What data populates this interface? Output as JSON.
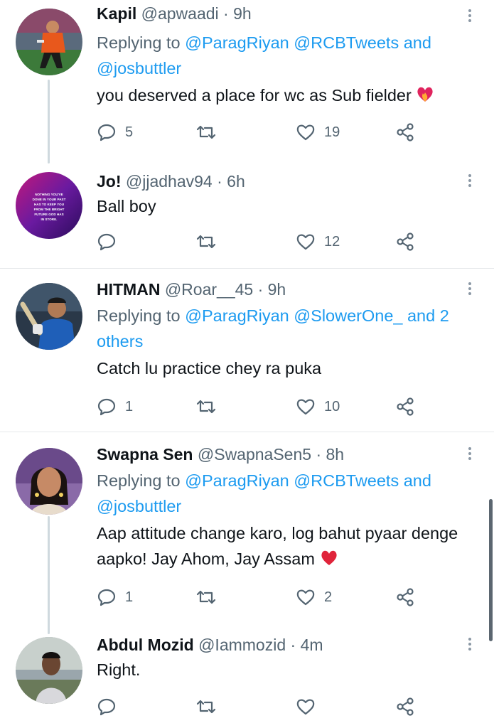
{
  "tweets": [
    {
      "name": "Kapil",
      "handle": "@apwaadi",
      "time": "· 9h",
      "replying_prefix": "Replying to ",
      "replying_mentions": "@ParagRiyan @RCBTweets and @josbuttler",
      "replying_suffix": "",
      "text": "you deserved a place for wc as Sub fielder",
      "text_emoji": "heart-on-fire",
      "replies": "5",
      "retweets": "",
      "likes": "19",
      "avatar_icon": "cricketer-orange-avatar"
    },
    {
      "name": "Jo!",
      "handle": "@jjadhav94",
      "time": "· 6h",
      "text": "Ball boy",
      "replies": "",
      "retweets": "",
      "likes": "12",
      "avatar_icon": "quote-purple-avatar",
      "avatar_text": [
        "NOTHING YOU'VE",
        "DONE IN YOUR PAST",
        "HAS TO KEEP YOU",
        "FROM THE BRIGHT",
        "FUTURE GOD HAS",
        "IN STORE."
      ]
    },
    {
      "name": "HITMAN",
      "handle": "@Roar__45",
      "time": "· 9h",
      "replying_prefix": "Replying to ",
      "replying_mentions": "@ParagRiyan @SlowerOne_ and 2 others",
      "text": "Catch lu practice chey ra puka",
      "replies": "1",
      "retweets": "",
      "likes": "10",
      "avatar_icon": "batsman-blue-avatar"
    },
    {
      "name": "Swapna Sen",
      "handle": "@SwapnaSen5",
      "time": "· 8h",
      "replying_prefix": "Replying to ",
      "replying_mentions": "@ParagRiyan @RCBTweets and @josbuttler",
      "text": "Aap attitude change karo, log bahut pyaar denge aapko! Jay Ahom, Jay Assam",
      "text_emoji": "red-heart",
      "replies": "1",
      "retweets": "",
      "likes": "2",
      "avatar_icon": "woman-portrait-avatar"
    },
    {
      "name": "Abdul Mozid",
      "handle": "@Iammozid",
      "time": "· 4m",
      "text": "Right.",
      "replies": "",
      "retweets": "",
      "likes": "",
      "avatar_icon": "man-portrait-avatar"
    }
  ],
  "colors": {
    "link": "#1d9bf0",
    "secondary_text": "#536471",
    "primary_text": "#0f1419",
    "divider": "#e6e8ea"
  }
}
